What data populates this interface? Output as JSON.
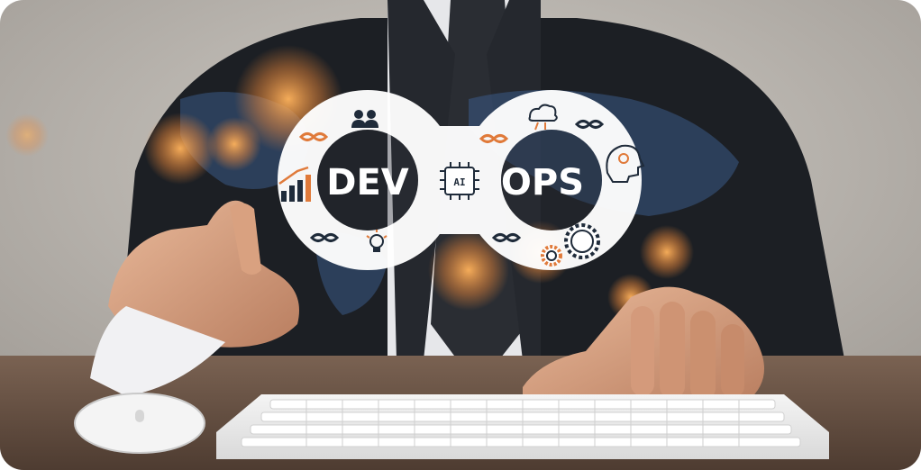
{
  "image": {
    "logo": {
      "left_word": "DEV",
      "right_word": "OPS",
      "chip_label": "AI"
    },
    "icons": [
      "team-icon",
      "infinity-icon",
      "growth-chart-icon",
      "lightbulb-icon",
      "cloud-sync-icon",
      "ai-head-icon",
      "gears-icon",
      "ai-chip-icon"
    ],
    "colors": {
      "logo_fill": "#ffffff",
      "logo_text": "#ffffff",
      "icon_dark": "#1f2b3a",
      "accent_orange": "#e07a3a",
      "suit": "#1c1f24",
      "backdrop": "#b9b6b1",
      "desk": "#6b5647"
    }
  }
}
